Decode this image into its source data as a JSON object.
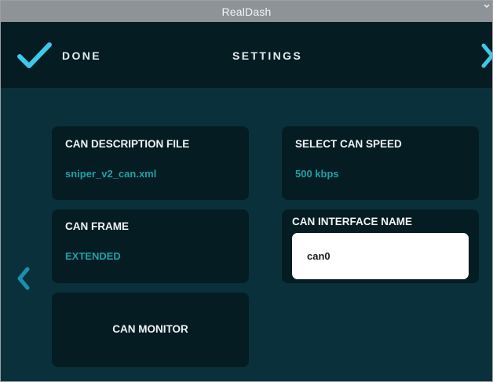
{
  "window": {
    "title": "RealDash"
  },
  "header": {
    "done_label": "DONE",
    "title": "SETTINGS"
  },
  "cards": {
    "can_description_file": {
      "title": "CAN DESCRIPTION FILE",
      "value": "sniper_v2_can.xml"
    },
    "can_frame": {
      "title": "CAN FRAME",
      "value": "EXTENDED"
    },
    "can_monitor": {
      "title": "CAN MONITOR"
    },
    "select_can_speed": {
      "title": "SELECT CAN SPEED",
      "value": "500 kbps"
    },
    "can_interface_name": {
      "title": "CAN INTERFACE NAME",
      "value": "can0"
    }
  },
  "icons": {
    "done": "checkmark-icon",
    "next": "chevron-right-icon",
    "previous": "chevron-left-icon",
    "window_control": "chevron-down-icon"
  },
  "colors": {
    "background": "#0a313b",
    "card": "#041c22",
    "accent": "#3fc7ea",
    "value_text": "#1ea2a5",
    "titlebar": "#8e9397"
  }
}
